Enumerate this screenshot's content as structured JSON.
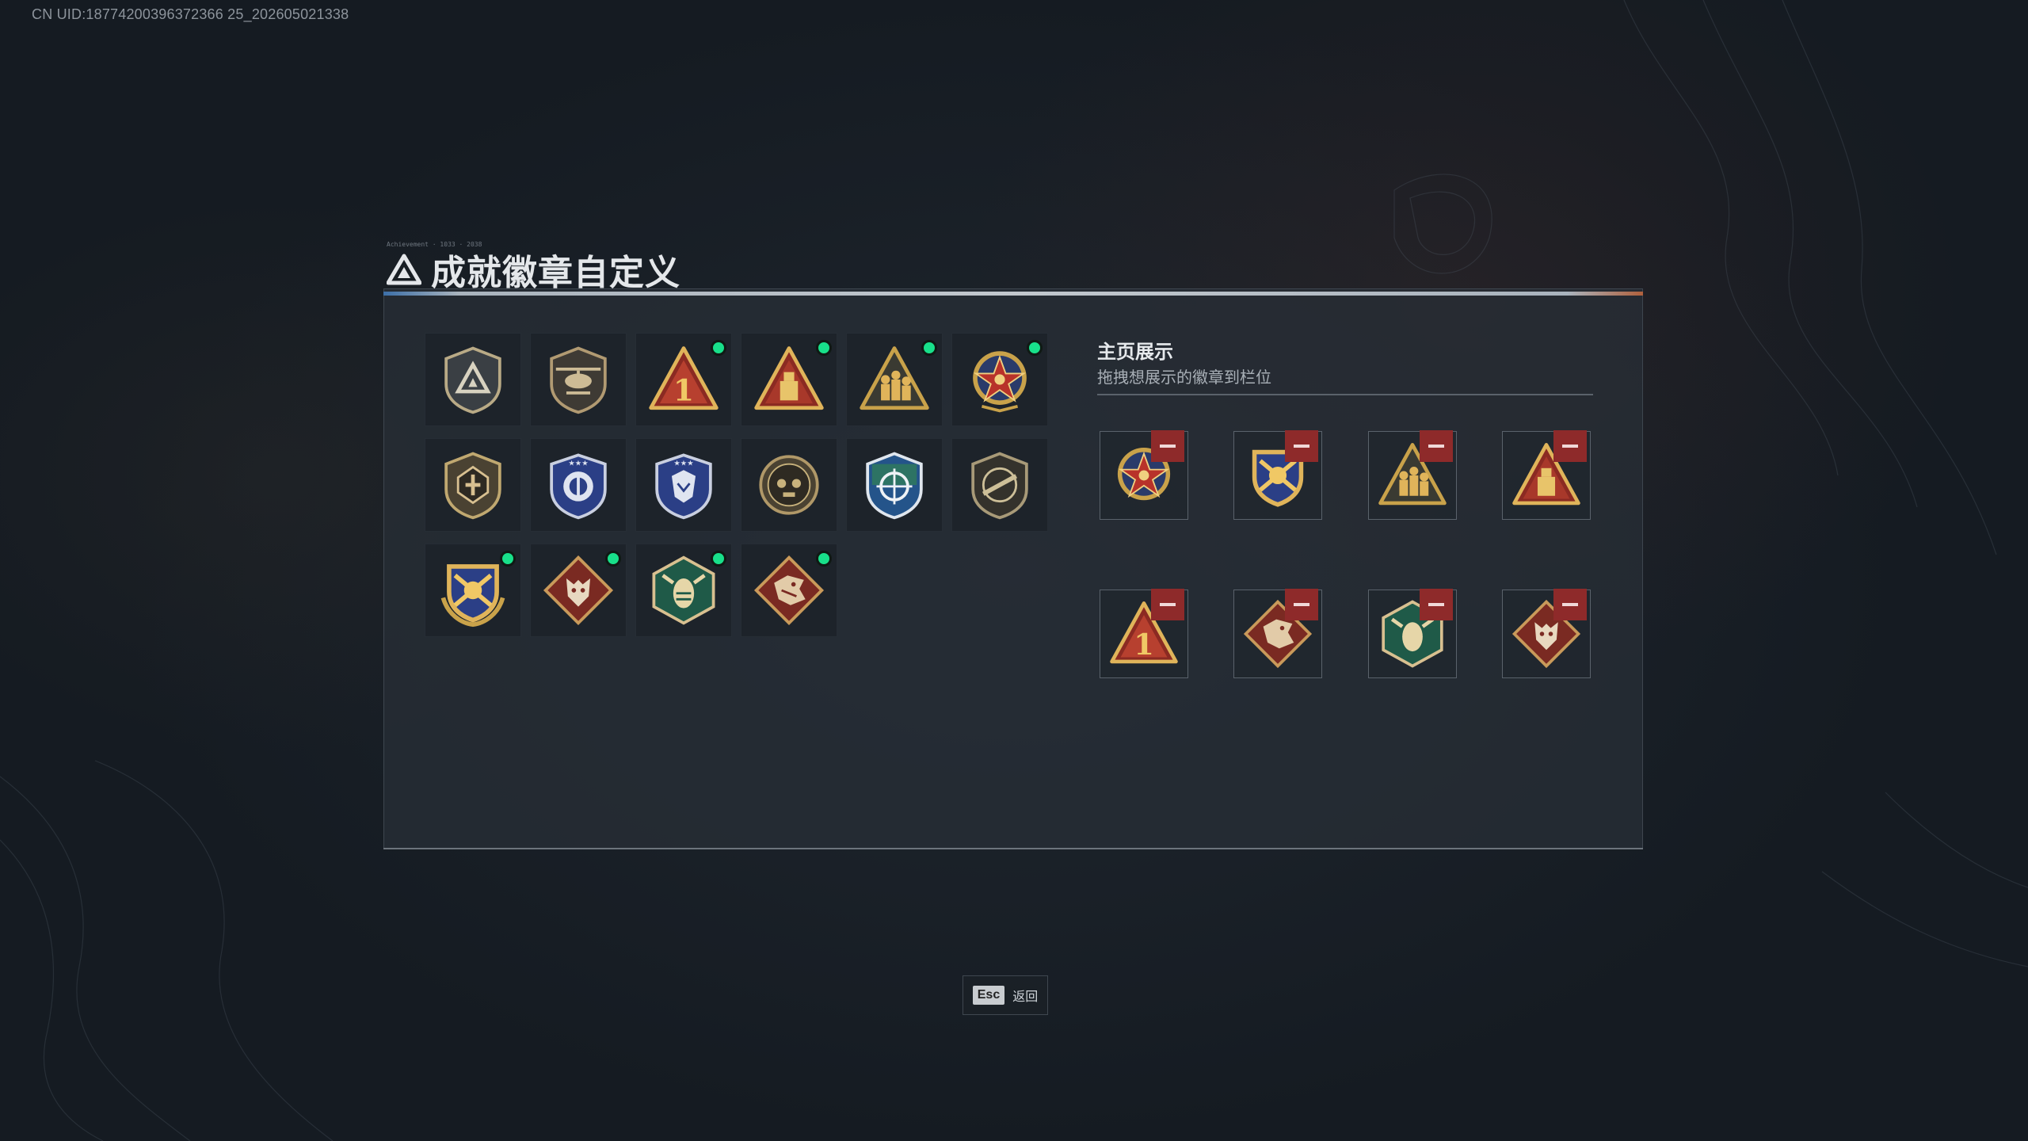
{
  "uid": "CN UID:18774200396372366 25_202605021338",
  "page": {
    "title": "成就徽章自定义",
    "title_micro": "Achievement · 1033 · 2038"
  },
  "badges": [
    {
      "icon": "shield-delta-icon",
      "new": false
    },
    {
      "icon": "helicopter-shield-icon",
      "new": false
    },
    {
      "icon": "triangle-number-one-icon",
      "new": true
    },
    {
      "icon": "triangle-vault-icon",
      "new": true
    },
    {
      "icon": "triangle-soldiers-icon",
      "new": true
    },
    {
      "icon": "star-medal-icon",
      "new": true
    },
    {
      "icon": "shield-wrench-icon",
      "new": false
    },
    {
      "icon": "blue-shield-shark-icon",
      "new": false
    },
    {
      "icon": "blue-shield-wolf-icon",
      "new": false
    },
    {
      "icon": "round-skull-icon",
      "new": false
    },
    {
      "icon": "green-shield-crosshair-icon",
      "new": false
    },
    {
      "icon": "shield-rifle-icon",
      "new": false
    },
    {
      "icon": "gold-crest-crossed-rifles-icon",
      "new": true
    },
    {
      "icon": "diamond-wolf-icon",
      "new": true
    },
    {
      "icon": "hex-green-hornet-icon",
      "new": true
    },
    {
      "icon": "diamond-dragon-icon",
      "new": true
    }
  ],
  "showcase": {
    "title": "主页展示",
    "subtitle": "拖拽想展示的徽章到栏位",
    "slots": [
      {
        "icon": "star-medal-icon"
      },
      {
        "icon": "gold-crest-crossed-rifles-icon"
      },
      {
        "icon": "triangle-soldiers-icon"
      },
      {
        "icon": "triangle-vault-icon"
      },
      {
        "icon": "triangle-number-one-icon"
      },
      {
        "icon": "diamond-dragon-icon"
      },
      {
        "icon": "hex-green-hornet-icon"
      },
      {
        "icon": "diamond-wolf-icon"
      }
    ]
  },
  "footer": {
    "esc_key": "Esc",
    "back_label": "返回"
  },
  "colors": {
    "new_dot": "#18e08a",
    "remove_btn": "#8e2a2a",
    "accent_gold": "#c9a24a",
    "accent_red": "#8b2a22"
  }
}
